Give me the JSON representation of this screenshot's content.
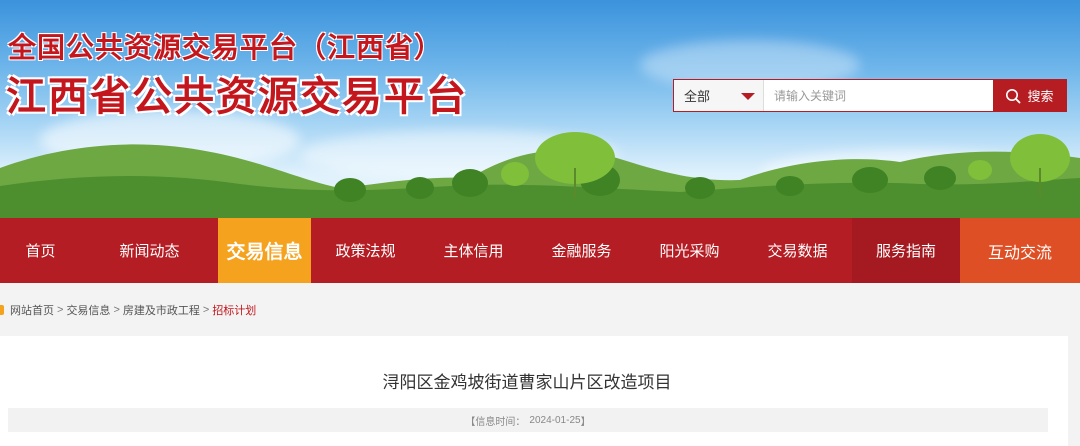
{
  "header": {
    "title_small": "全国公共资源交易平台（江西省）",
    "title_big": "江西省公共资源交易平台"
  },
  "search": {
    "category": "全部",
    "placeholder": "请输入关键词",
    "button_label": "搜索",
    "icon": "search-icon"
  },
  "nav": {
    "items": [
      {
        "label": "首页"
      },
      {
        "label": "新闻动态"
      },
      {
        "label": "交易信息"
      },
      {
        "label": "政策法规"
      },
      {
        "label": "主体信用"
      },
      {
        "label": "金融服务"
      },
      {
        "label": "阳光采购"
      },
      {
        "label": "交易数据"
      },
      {
        "label": "服务指南"
      },
      {
        "label": "互动交流"
      }
    ],
    "active_label": "交易信息"
  },
  "breadcrumb": {
    "items": [
      "网站首页",
      "交易信息",
      "房建及市政工程"
    ],
    "current": "招标计划",
    "separator": ">"
  },
  "article": {
    "title": "浔阳区金鸡坡街道曹家山片区改造项目",
    "meta_prefix": "【信息时间：",
    "date": "2024-01-25",
    "meta_suffix": "】"
  },
  "colors": {
    "brand_red": "#b41d23",
    "active_orange": "#f5a21f",
    "accent_orange": "#de4f25",
    "title_red": "#c3161d"
  }
}
